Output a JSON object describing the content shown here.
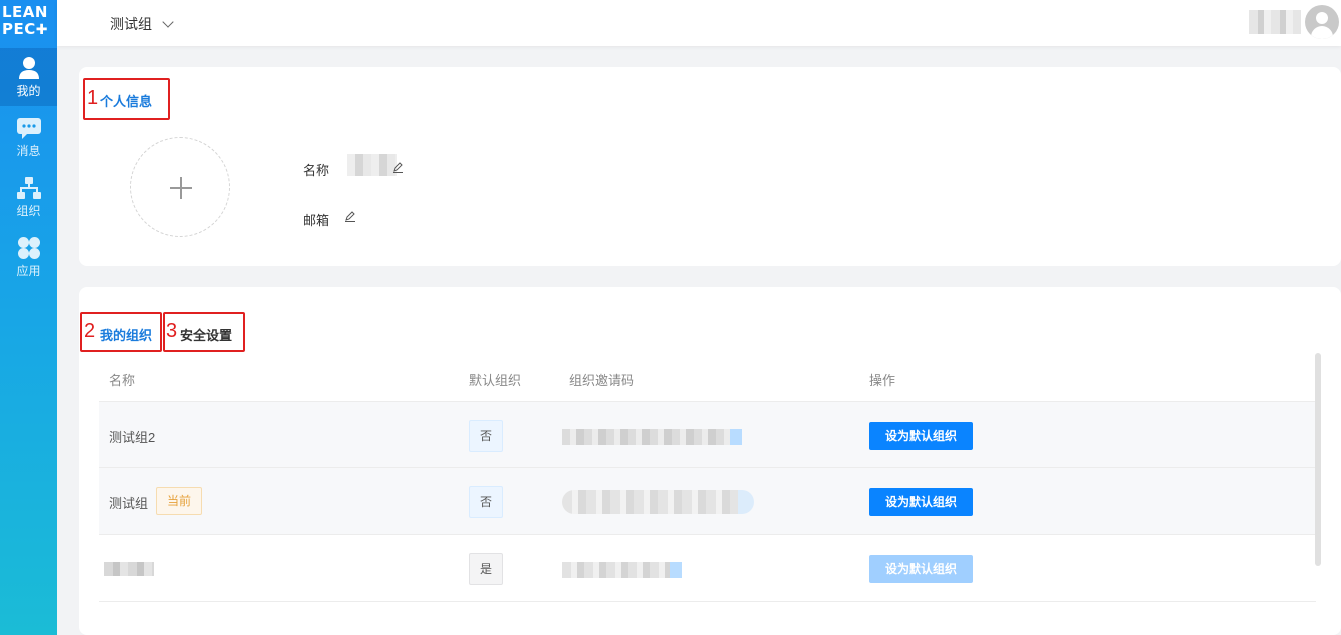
{
  "logo": {
    "line1": "LEAN",
    "line2": "PEC"
  },
  "sidebar": {
    "items": [
      {
        "label": "我的",
        "icon": "user-icon",
        "active": true
      },
      {
        "label": "消息",
        "icon": "message-icon",
        "active": false
      },
      {
        "label": "组织",
        "icon": "org-tree-icon",
        "active": false
      },
      {
        "label": "应用",
        "icon": "apps-icon",
        "active": false
      }
    ]
  },
  "header": {
    "current_org": "测试组"
  },
  "profile": {
    "section_number": "1",
    "title": "个人信息",
    "name_label": "名称",
    "email_label": "邮箱"
  },
  "org_section": {
    "tab1_number": "2",
    "tab1_label": "我的组织",
    "tab2_number": "3",
    "tab2_label": "安全设置",
    "columns": [
      "名称",
      "默认组织",
      "组织邀请码",
      "操作"
    ],
    "rows": [
      {
        "name": "测试组2",
        "badge": "",
        "is_default": "否",
        "action": "设为默认组织",
        "disabled": false
      },
      {
        "name": "测试组",
        "badge": "当前",
        "is_default": "否",
        "action": "设为默认组织",
        "disabled": false
      },
      {
        "name": "",
        "badge": "",
        "is_default": "是",
        "action": "设为默认组织",
        "disabled": true
      }
    ]
  },
  "colors": {
    "accent": "#0a84ff",
    "sidebar_top": "#1a8ff0",
    "sidebar_bottom": "#1bbcd6",
    "annotation": "#e02020"
  }
}
